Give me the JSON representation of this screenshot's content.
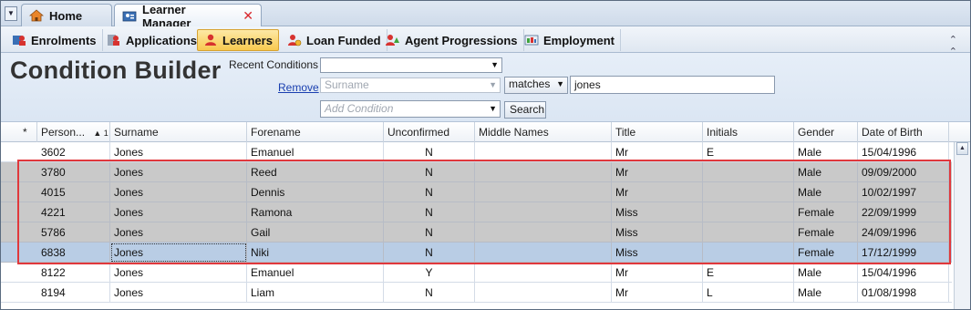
{
  "tabs": {
    "home": "Home",
    "learner_manager": "Learner Manager",
    "close_symbol": "✕"
  },
  "ribbon": {
    "items": [
      "Enrolments",
      "Applications",
      "Learners",
      "Loan Funded",
      "Agent Progressions",
      "Employment"
    ],
    "active": "Learners"
  },
  "builder": {
    "title": "Condition Builder",
    "recent_label": "Recent Conditions",
    "recent_value": "",
    "remove_label": "Remove",
    "field_value": "Surname",
    "operator_value": "matches",
    "criteria_value": "jones",
    "add_condition_placeholder": "Add Condition",
    "search_label": "Search"
  },
  "grid": {
    "sort_marker": "▲ 1",
    "columns": [
      "*",
      "Person...",
      "Surname",
      "Forename",
      "Unconfirmed",
      "Middle Names",
      "Title",
      "Initials",
      "Gender",
      "Date of Birth"
    ],
    "rows": [
      {
        "person": "3602",
        "surname": "Jones",
        "forename": "Emanuel",
        "unconfirmed": "N",
        "middle": "",
        "title": "Mr",
        "initials": "E",
        "gender": "Male",
        "dob": "15/04/1996"
      },
      {
        "person": "3780",
        "surname": "Jones",
        "forename": "Reed",
        "unconfirmed": "N",
        "middle": "",
        "title": "Mr",
        "initials": "",
        "gender": "Male",
        "dob": "09/09/2000"
      },
      {
        "person": "4015",
        "surname": "Jones",
        "forename": "Dennis",
        "unconfirmed": "N",
        "middle": "",
        "title": "Mr",
        "initials": "",
        "gender": "Male",
        "dob": "10/02/1997"
      },
      {
        "person": "4221",
        "surname": "Jones",
        "forename": "Ramona",
        "unconfirmed": "N",
        "middle": "",
        "title": "Miss",
        "initials": "",
        "gender": "Female",
        "dob": "22/09/1999"
      },
      {
        "person": "5786",
        "surname": "Jones",
        "forename": "Gail",
        "unconfirmed": "N",
        "middle": "",
        "title": "Miss",
        "initials": "",
        "gender": "Female",
        "dob": "24/09/1996"
      },
      {
        "person": "6838",
        "surname": "Jones",
        "forename": "Niki",
        "unconfirmed": "N",
        "middle": "",
        "title": "Miss",
        "initials": "",
        "gender": "Female",
        "dob": "17/12/1999"
      },
      {
        "person": "8122",
        "surname": "Jones",
        "forename": "Emanuel",
        "unconfirmed": "Y",
        "middle": "",
        "title": "Mr",
        "initials": "E",
        "gender": "Male",
        "dob": "15/04/1996"
      },
      {
        "person": "8194",
        "surname": "Jones",
        "forename": "Liam",
        "unconfirmed": "N",
        "middle": "",
        "title": "Mr",
        "initials": "L",
        "gender": "Male",
        "dob": "01/08/1998"
      }
    ]
  },
  "colors": {
    "highlight": "#e0383c",
    "active_tab": "#f8c94f",
    "selected_row": "#c9c9c9",
    "focused_row": "#b9cde5"
  }
}
